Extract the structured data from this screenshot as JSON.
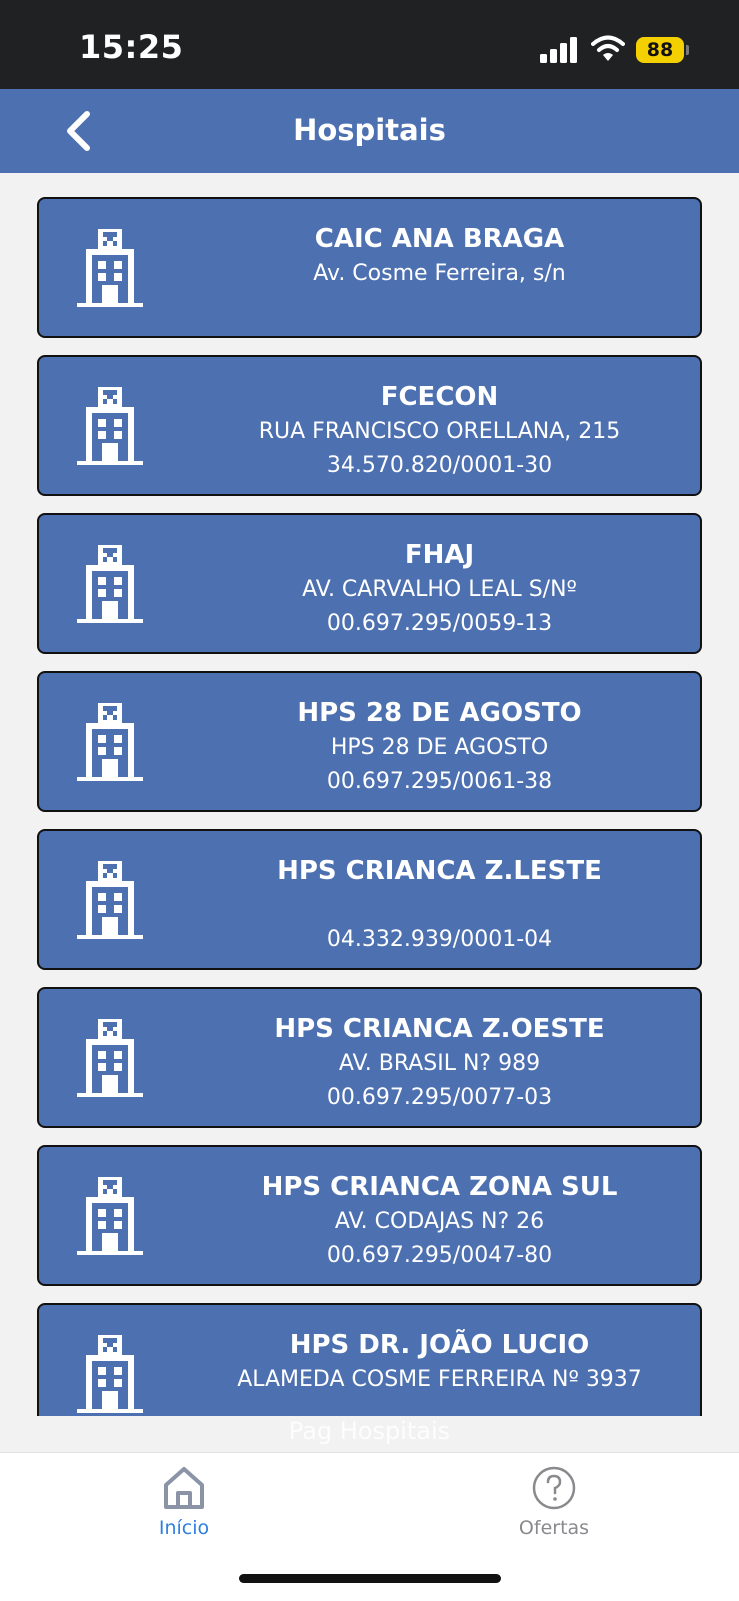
{
  "status_bar": {
    "time": "15:25",
    "battery_level": "88",
    "battery_color": "#f5d000",
    "icons": [
      "signal-icon",
      "wifi-icon",
      "battery-icon"
    ]
  },
  "header": {
    "title": "Hospitais",
    "back_icon": "chevron-left-icon",
    "background_color": "#4d70b1"
  },
  "hospitals": [
    {
      "name": "CAIC ANA BRAGA",
      "line1": "Av. Cosme Ferreira, s/n",
      "line2": ""
    },
    {
      "name": "FCECON",
      "line1": "RUA FRANCISCO ORELLANA, 215",
      "line2": "34.570.820/0001-30"
    },
    {
      "name": "FHAJ",
      "line1": "AV. CARVALHO LEAL S/Nº",
      "line2": "00.697.295/0059-13"
    },
    {
      "name": "HPS 28 DE AGOSTO",
      "line1": "HPS 28 DE AGOSTO",
      "line2": "00.697.295/0061-38"
    },
    {
      "name": "HPS CRIANCA Z.LESTE",
      "line1": "",
      "line2": "04.332.939/0001-04"
    },
    {
      "name": "HPS CRIANCA Z.OESTE",
      "line1": "AV. BRASIL N? 989",
      "line2": "00.697.295/0077-03"
    },
    {
      "name": "HPS CRIANCA ZONA SUL",
      "line1": "AV. CODAJAS N? 26",
      "line2": "00.697.295/0047-80"
    },
    {
      "name": "HPS DR. JOÃO LUCIO",
      "line1": "ALAMEDA COSME FERREIRA Nº 3937",
      "line2": ""
    }
  ],
  "watermark": "Pag Hospitais",
  "tabbar": {
    "tabs": [
      {
        "label": "Início",
        "icon": "home-icon",
        "active": true,
        "color": "#2f7fe0"
      },
      {
        "label": "Ofertas",
        "icon": "help-circle-icon",
        "active": false,
        "color": "#8a8a8e"
      }
    ]
  }
}
